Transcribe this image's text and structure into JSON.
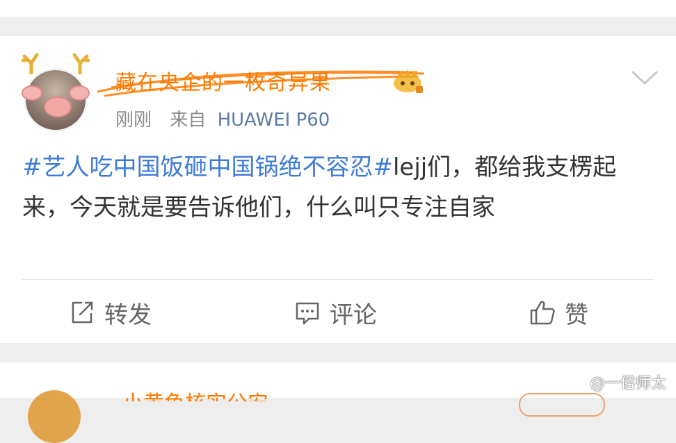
{
  "post": {
    "username": "藏在央企的一枚奇异果",
    "time": "刚刚",
    "source_prefix": "来自",
    "device": "HUAWEI P60",
    "topic": "#艺人吃中国饭砸中国锅绝不容忍#",
    "body": "lejj们，都给我支楞起来，今天就是要告诉他们，什么叫只专注自家"
  },
  "actions": {
    "repost_label": "转发",
    "comment_label": "评论",
    "like_label": "赞"
  },
  "next_post": {
    "username": "小黄鱼核实公安"
  },
  "watermark": {
    "text": "@一俗师太"
  },
  "colors": {
    "username": "#ff7a00",
    "topic": "#3d7bd6",
    "device": "#5b7ba3",
    "body_text": "#333333",
    "meta_text": "#8c8c8c",
    "page_bg": "#eeeeee"
  },
  "icons": {
    "repost": "share-square-icon",
    "comment": "comment-bubble-icon",
    "like": "thumbs-up-icon",
    "more": "chevron-down-icon",
    "badge": "crown-badge-icon"
  }
}
